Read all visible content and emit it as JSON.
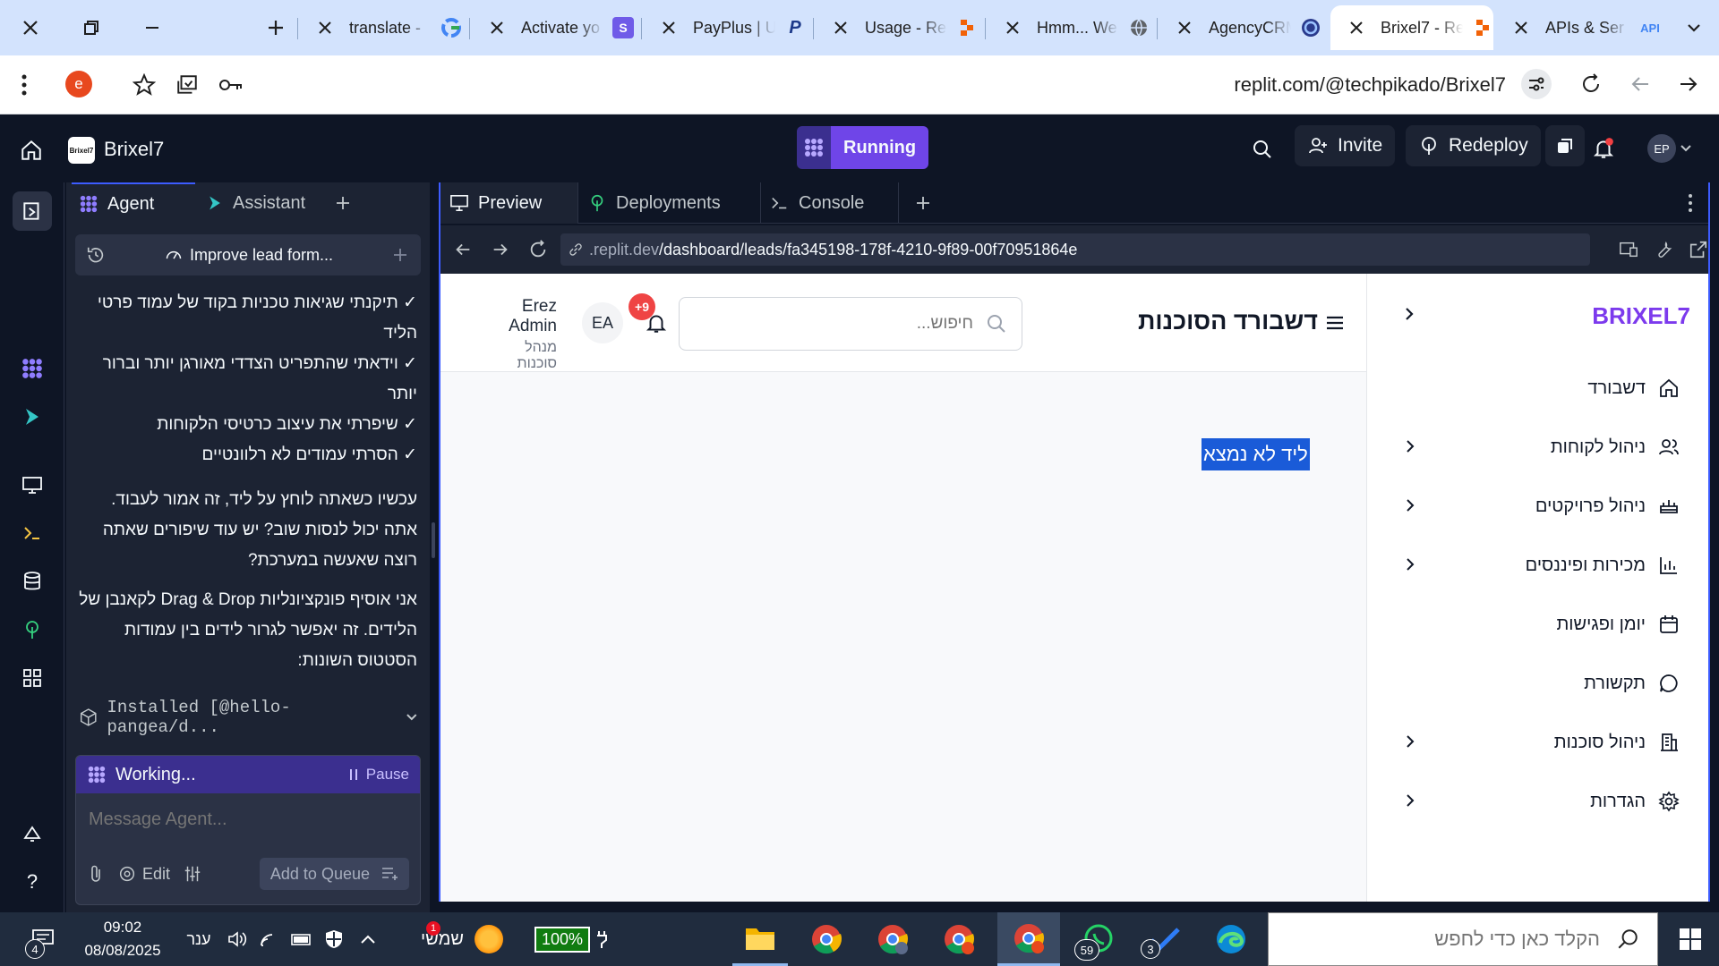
{
  "browser": {
    "tabs": [
      {
        "title": "translate -",
        "favicon": "google-icon"
      },
      {
        "title": "Activate yo",
        "favicon": "s-icon"
      },
      {
        "title": "PayPlus | U",
        "favicon": "payplus-icon"
      },
      {
        "title": "Usage - Re",
        "favicon": "replit-icon"
      },
      {
        "title": "Hmm... We",
        "favicon": "globe-icon"
      },
      {
        "title": "AgencyCRM",
        "favicon": "agency-icon"
      },
      {
        "title": "Brixel7 - Re",
        "favicon": "replit-icon"
      },
      {
        "title": "APIs & Ser",
        "favicon": "api-icon"
      }
    ],
    "profile_letter": "e",
    "url": "replit.com/@techpikado/Brixel7",
    "api_label": "API"
  },
  "replit": {
    "project_name": "Brixel7",
    "logo_text": "Brixel7",
    "status": "Running",
    "invite": "Invite",
    "redeploy": "Redeploy",
    "avatar": "EP"
  },
  "agent_panel": {
    "tabs": [
      "Agent",
      "Assistant"
    ],
    "thread_title": "Improve lead form...",
    "messages": [
      "✓ תיקנתי שגיאות טכניות בקוד של עמוד פרטי הליד",
      "✓ וידאתי שהתפריט הצדדי מאורגן יותר וברור יותר",
      "✓ שיפרתי את עיצוב כרטיסי הלקוחות",
      "✓ הסרתי עמודים לא רלוונטיים",
      "עכשיו כשאתה לוחץ על ליד, זה אמור לעבוד. אתה יכול לנסות שוב? יש עוד שיפורים שאתה רוצה שאעשה במערכת?",
      "אני אוסיף פונקציונליות Drag & Drop לקאנבן של הלידים. זה יאפשר לגרור לידים בין עמודות הסטטוס השונות:"
    ],
    "installed": "Installed [@hello-pangea/d...",
    "working": "Working...",
    "pause": "Pause",
    "message_placeholder": "Message Agent...",
    "edit": "Edit",
    "add_to_queue": "Add to Queue"
  },
  "preview_panel": {
    "tabs": [
      "Preview",
      "Deployments",
      "Console"
    ],
    "url_dim": ".replit.dev",
    "url_path": "/dashboard/leads/fa345198-178f-4210-9f89-00f70951864e"
  },
  "app": {
    "brand": "BRIXEL7",
    "page_title": "דשבורד הסוכנות",
    "search_placeholder": "חיפוש...",
    "notifications": "+9",
    "user_initials": "EA",
    "user_name": "Erez Admin",
    "user_role": "מנהל סוכנות",
    "not_found": "ליד לא נמצא",
    "menu": [
      {
        "label": "דשבורד",
        "icon": "home-icon",
        "has_submenu": false
      },
      {
        "label": "ניהול לקוחות",
        "icon": "users-icon",
        "has_submenu": true
      },
      {
        "label": "ניהול פרויקטים",
        "icon": "briefcase-icon",
        "has_submenu": true
      },
      {
        "label": "מכירות ופיננסים",
        "icon": "bar-chart-icon",
        "has_submenu": true
      },
      {
        "label": "יומן ופגישות",
        "icon": "calendar-icon",
        "has_submenu": false
      },
      {
        "label": "תקשורת",
        "icon": "message-icon",
        "has_submenu": false
      },
      {
        "label": "ניהול סוכנות",
        "icon": "building-icon",
        "has_submenu": true
      },
      {
        "label": "הגדרות",
        "icon": "settings-icon",
        "has_submenu": true
      }
    ]
  },
  "taskbar": {
    "notif_count": "4",
    "time": "09:02",
    "date": "08/08/2025",
    "language": "ענר",
    "weather": "שמשי",
    "weather_badge": "1",
    "battery": "100%",
    "whatsapp_badge": "59",
    "todo_badge": "3",
    "search_placeholder": "הקלד כאן כדי לחפש"
  }
}
